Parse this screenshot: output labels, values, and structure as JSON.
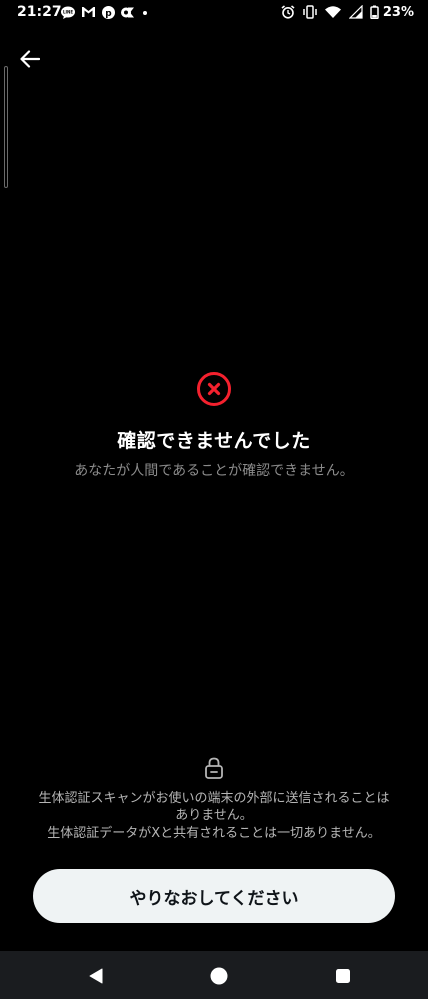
{
  "status_bar": {
    "time": "21:27",
    "battery": "23%"
  },
  "error": {
    "title": "確認できませんでした",
    "subtitle": "あなたが人間であることが確認できません。"
  },
  "privacy": {
    "line1": "生体認証スキャンがお使いの端末の外部に送信されることは",
    "line2": "ありません。",
    "line3": "生体認証データがXと共有されることは一切ありません。"
  },
  "retry_button_label": "やりなおしてください",
  "colors": {
    "background": "#000000",
    "error_red": "#f4212e",
    "button_bg": "#eff3f4",
    "button_text": "#0f1419",
    "subtitle": "#8b8b8b"
  },
  "icons": {
    "back": "arrow-left-icon",
    "error": "error-x-circle-icon",
    "lock": "lock-icon"
  }
}
